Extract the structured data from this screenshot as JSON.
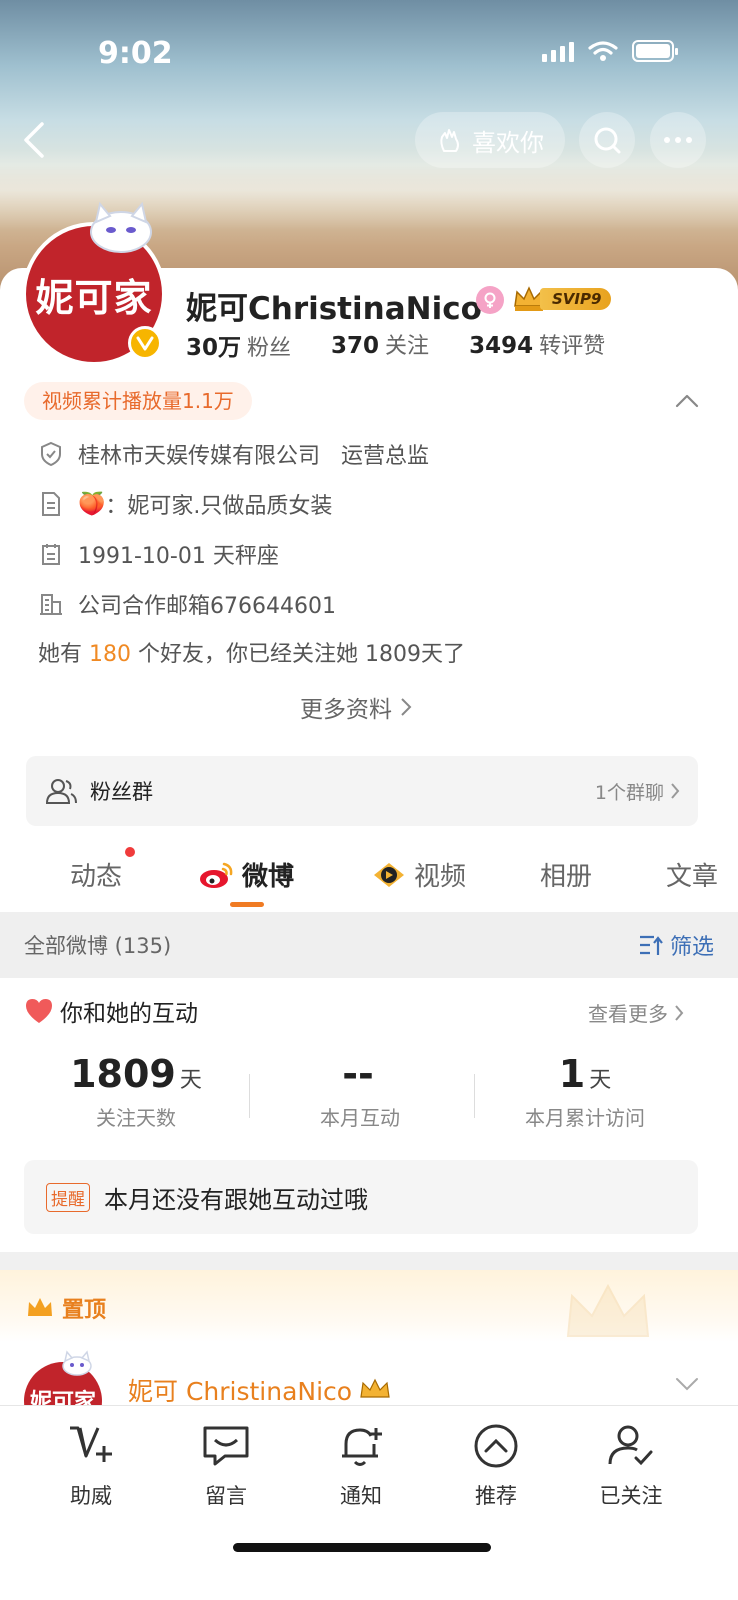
{
  "status_bar": {
    "time": "9:02"
  },
  "header": {
    "like_button_label": "喜欢你"
  },
  "profile": {
    "avatar_text": "妮可家",
    "name": "妮可ChristinaNico",
    "svip_label": "SVIP9",
    "stats": [
      {
        "value": "30万",
        "label": "粉丝"
      },
      {
        "value": "370",
        "label": "关注"
      },
      {
        "value": "3494",
        "label": "转评赞"
      }
    ],
    "video_plays": "视频累计播放量1.1万",
    "info": {
      "company": "桂林市天娱传媒有限公司   运营总监",
      "bio_emoji": "🍑",
      "bio": "：妮可家.只做品质女装",
      "birthday": "1991-10-01 天秤座",
      "email": "公司合作邮箱676644601"
    },
    "friends_prefix": "她有",
    "friends_count": "180",
    "friends_suffix": "个好友，你已经关注她 1809天了",
    "more_info": "更多资料"
  },
  "fan_group": {
    "label": "粉丝群",
    "right": "1个群聊"
  },
  "tabs": [
    {
      "label": "动态"
    },
    {
      "label": "微博"
    },
    {
      "label": "视频"
    },
    {
      "label": "相册"
    },
    {
      "label": "文章"
    }
  ],
  "filter_bar": {
    "all_posts": "全部微博 (135)",
    "filter": "筛选"
  },
  "interaction": {
    "title": "你和她的互动",
    "see_more": "查看更多",
    "metrics": [
      {
        "value": "1809",
        "unit": "天",
        "caption": "关注天数"
      },
      {
        "value": "--",
        "unit": "",
        "caption": "本月互动"
      },
      {
        "value": "1",
        "unit": "天",
        "caption": "本月累计访问"
      }
    ],
    "reminder_tag": "提醒",
    "reminder_text": "本月还没有跟她互动过哦"
  },
  "pinned": {
    "label": "置顶",
    "post_author": "妮可 ChristinaNico",
    "post_avatar_text": "妮可家"
  },
  "bottom_nav": [
    {
      "label": "助威",
      "icon": "cheer-v-icon"
    },
    {
      "label": "留言",
      "icon": "message-icon"
    },
    {
      "label": "通知",
      "icon": "bell-icon"
    },
    {
      "label": "推荐",
      "icon": "recommend-icon"
    },
    {
      "label": "已关注",
      "icon": "followed-user-icon"
    }
  ],
  "colors": {
    "accent_orange": "#f07b23",
    "link_blue": "#3d6fb6",
    "avatar_red": "#c1242b"
  }
}
